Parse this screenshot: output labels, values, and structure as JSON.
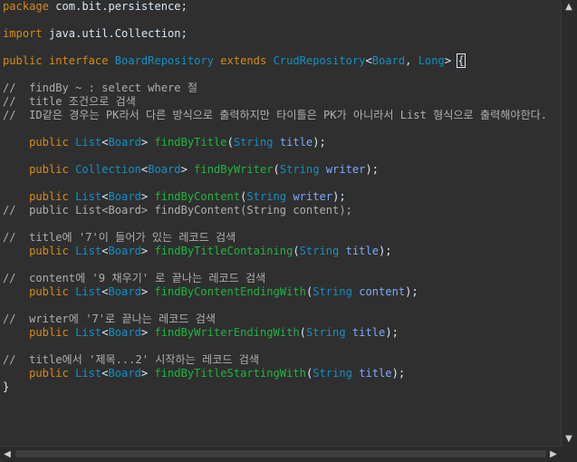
{
  "editor": {
    "lines": [
      [
        [
          "kw",
          "package"
        ],
        [
          "plain",
          " com.bit.persistence;"
        ]
      ],
      [],
      [
        [
          "kw",
          "import"
        ],
        [
          "plain",
          " java.util.Collection;"
        ]
      ],
      [],
      [
        [
          "kw",
          "public"
        ],
        [
          "plain",
          " "
        ],
        [
          "kw",
          "interface"
        ],
        [
          "plain",
          " "
        ],
        [
          "typ",
          "BoardRepository"
        ],
        [
          "plain",
          " "
        ],
        [
          "kw",
          "extends"
        ],
        [
          "plain",
          " "
        ],
        [
          "typ",
          "CrudRepository"
        ],
        [
          "plain",
          "<"
        ],
        [
          "typ",
          "Board"
        ],
        [
          "plain",
          ", "
        ],
        [
          "typ",
          "Long"
        ],
        [
          "plain",
          "> "
        ],
        [
          "bracket",
          "{"
        ]
      ],
      [],
      [
        [
          "cm",
          "//  findBy ~ : select where 절"
        ]
      ],
      [
        [
          "cm",
          "//  title 조건으로 검색"
        ]
      ],
      [
        [
          "cm",
          "//  ID같은 경우는 PK라서 다른 방식으로 출력하지만 타이틀은 PK가 아니라서 List 형식으로 출력해야한다."
        ]
      ],
      [],
      [
        [
          "plain",
          "    "
        ],
        [
          "kw",
          "public"
        ],
        [
          "plain",
          " "
        ],
        [
          "typ",
          "List"
        ],
        [
          "plain",
          "<"
        ],
        [
          "typ",
          "Board"
        ],
        [
          "plain",
          "> "
        ],
        [
          "method",
          "findByTitle"
        ],
        [
          "plain",
          "("
        ],
        [
          "typ",
          "String"
        ],
        [
          "plain",
          " "
        ],
        [
          "param",
          "title"
        ],
        [
          "plain",
          ");"
        ]
      ],
      [],
      [
        [
          "plain",
          "    "
        ],
        [
          "kw",
          "public"
        ],
        [
          "plain",
          " "
        ],
        [
          "typ",
          "Collection"
        ],
        [
          "plain",
          "<"
        ],
        [
          "typ",
          "Board"
        ],
        [
          "plain",
          "> "
        ],
        [
          "method",
          "findByWriter"
        ],
        [
          "plain",
          "("
        ],
        [
          "typ",
          "String"
        ],
        [
          "plain",
          " "
        ],
        [
          "param",
          "writer"
        ],
        [
          "plain",
          ");"
        ]
      ],
      [],
      [
        [
          "plain",
          "    "
        ],
        [
          "kw",
          "public"
        ],
        [
          "plain",
          " "
        ],
        [
          "typ",
          "List"
        ],
        [
          "plain",
          "<"
        ],
        [
          "typ",
          "Board"
        ],
        [
          "plain",
          "> "
        ],
        [
          "method",
          "findByContent"
        ],
        [
          "plain",
          "("
        ],
        [
          "typ",
          "String"
        ],
        [
          "plain",
          " "
        ],
        [
          "param",
          "writer"
        ],
        [
          "plain",
          ");"
        ]
      ],
      [
        [
          "cm",
          "//  public List<Board> findByContent(String content);"
        ]
      ],
      [],
      [
        [
          "cm",
          "//  title에 '7'이 들어가 있는 레코드 검색"
        ]
      ],
      [
        [
          "plain",
          "    "
        ],
        [
          "kw",
          "public"
        ],
        [
          "plain",
          " "
        ],
        [
          "typ",
          "List"
        ],
        [
          "plain",
          "<"
        ],
        [
          "typ",
          "Board"
        ],
        [
          "plain",
          "> "
        ],
        [
          "method",
          "findByTitleContaining"
        ],
        [
          "plain",
          "("
        ],
        [
          "typ",
          "String"
        ],
        [
          "plain",
          " "
        ],
        [
          "param",
          "title"
        ],
        [
          "plain",
          ");"
        ]
      ],
      [],
      [
        [
          "cm",
          "//  content에 '9 채우기' 로 끝나는 레코드 검색"
        ]
      ],
      [
        [
          "plain",
          "    "
        ],
        [
          "kw",
          "public"
        ],
        [
          "plain",
          " "
        ],
        [
          "typ",
          "List"
        ],
        [
          "plain",
          "<"
        ],
        [
          "typ",
          "Board"
        ],
        [
          "plain",
          "> "
        ],
        [
          "method",
          "findByContentEndingWith"
        ],
        [
          "plain",
          "("
        ],
        [
          "typ",
          "String"
        ],
        [
          "plain",
          " "
        ],
        [
          "param",
          "content"
        ],
        [
          "plain",
          ");"
        ]
      ],
      [],
      [
        [
          "cm",
          "//  writer에 '7'로 끝나는 레코드 검색"
        ]
      ],
      [
        [
          "plain",
          "    "
        ],
        [
          "kw",
          "public"
        ],
        [
          "plain",
          " "
        ],
        [
          "typ",
          "List"
        ],
        [
          "plain",
          "<"
        ],
        [
          "typ",
          "Board"
        ],
        [
          "plain",
          "> "
        ],
        [
          "method",
          "findByWriterEndingWith"
        ],
        [
          "plain",
          "("
        ],
        [
          "typ",
          "String"
        ],
        [
          "plain",
          " "
        ],
        [
          "param",
          "title"
        ],
        [
          "plain",
          ");"
        ]
      ],
      [],
      [
        [
          "cm",
          "//  title에서 '제목...2' 시작하는 레코드 검색"
        ]
      ],
      [
        [
          "plain",
          "    "
        ],
        [
          "kw",
          "public"
        ],
        [
          "plain",
          " "
        ],
        [
          "typ",
          "List"
        ],
        [
          "plain",
          "<"
        ],
        [
          "typ",
          "Board"
        ],
        [
          "plain",
          "> "
        ],
        [
          "method",
          "findByTitleStartingWith"
        ],
        [
          "plain",
          "("
        ],
        [
          "typ",
          "String"
        ],
        [
          "plain",
          " "
        ],
        [
          "param",
          "title"
        ],
        [
          "plain",
          ");"
        ]
      ],
      [
        [
          "plain",
          "}"
        ]
      ]
    ],
    "current_line_index": 28
  },
  "scrollbars": {
    "up_arrow": "▲",
    "down_arrow": "▼",
    "left_arrow": "◀",
    "right_arrow": "▶"
  },
  "colors": {
    "background": "#2f2f2f",
    "keyword": "#d78a18",
    "type": "#1290c3",
    "method": "#1eb540",
    "parameter": "#79abff",
    "comment": "#aeaeae",
    "text": "#d9e8f7"
  }
}
